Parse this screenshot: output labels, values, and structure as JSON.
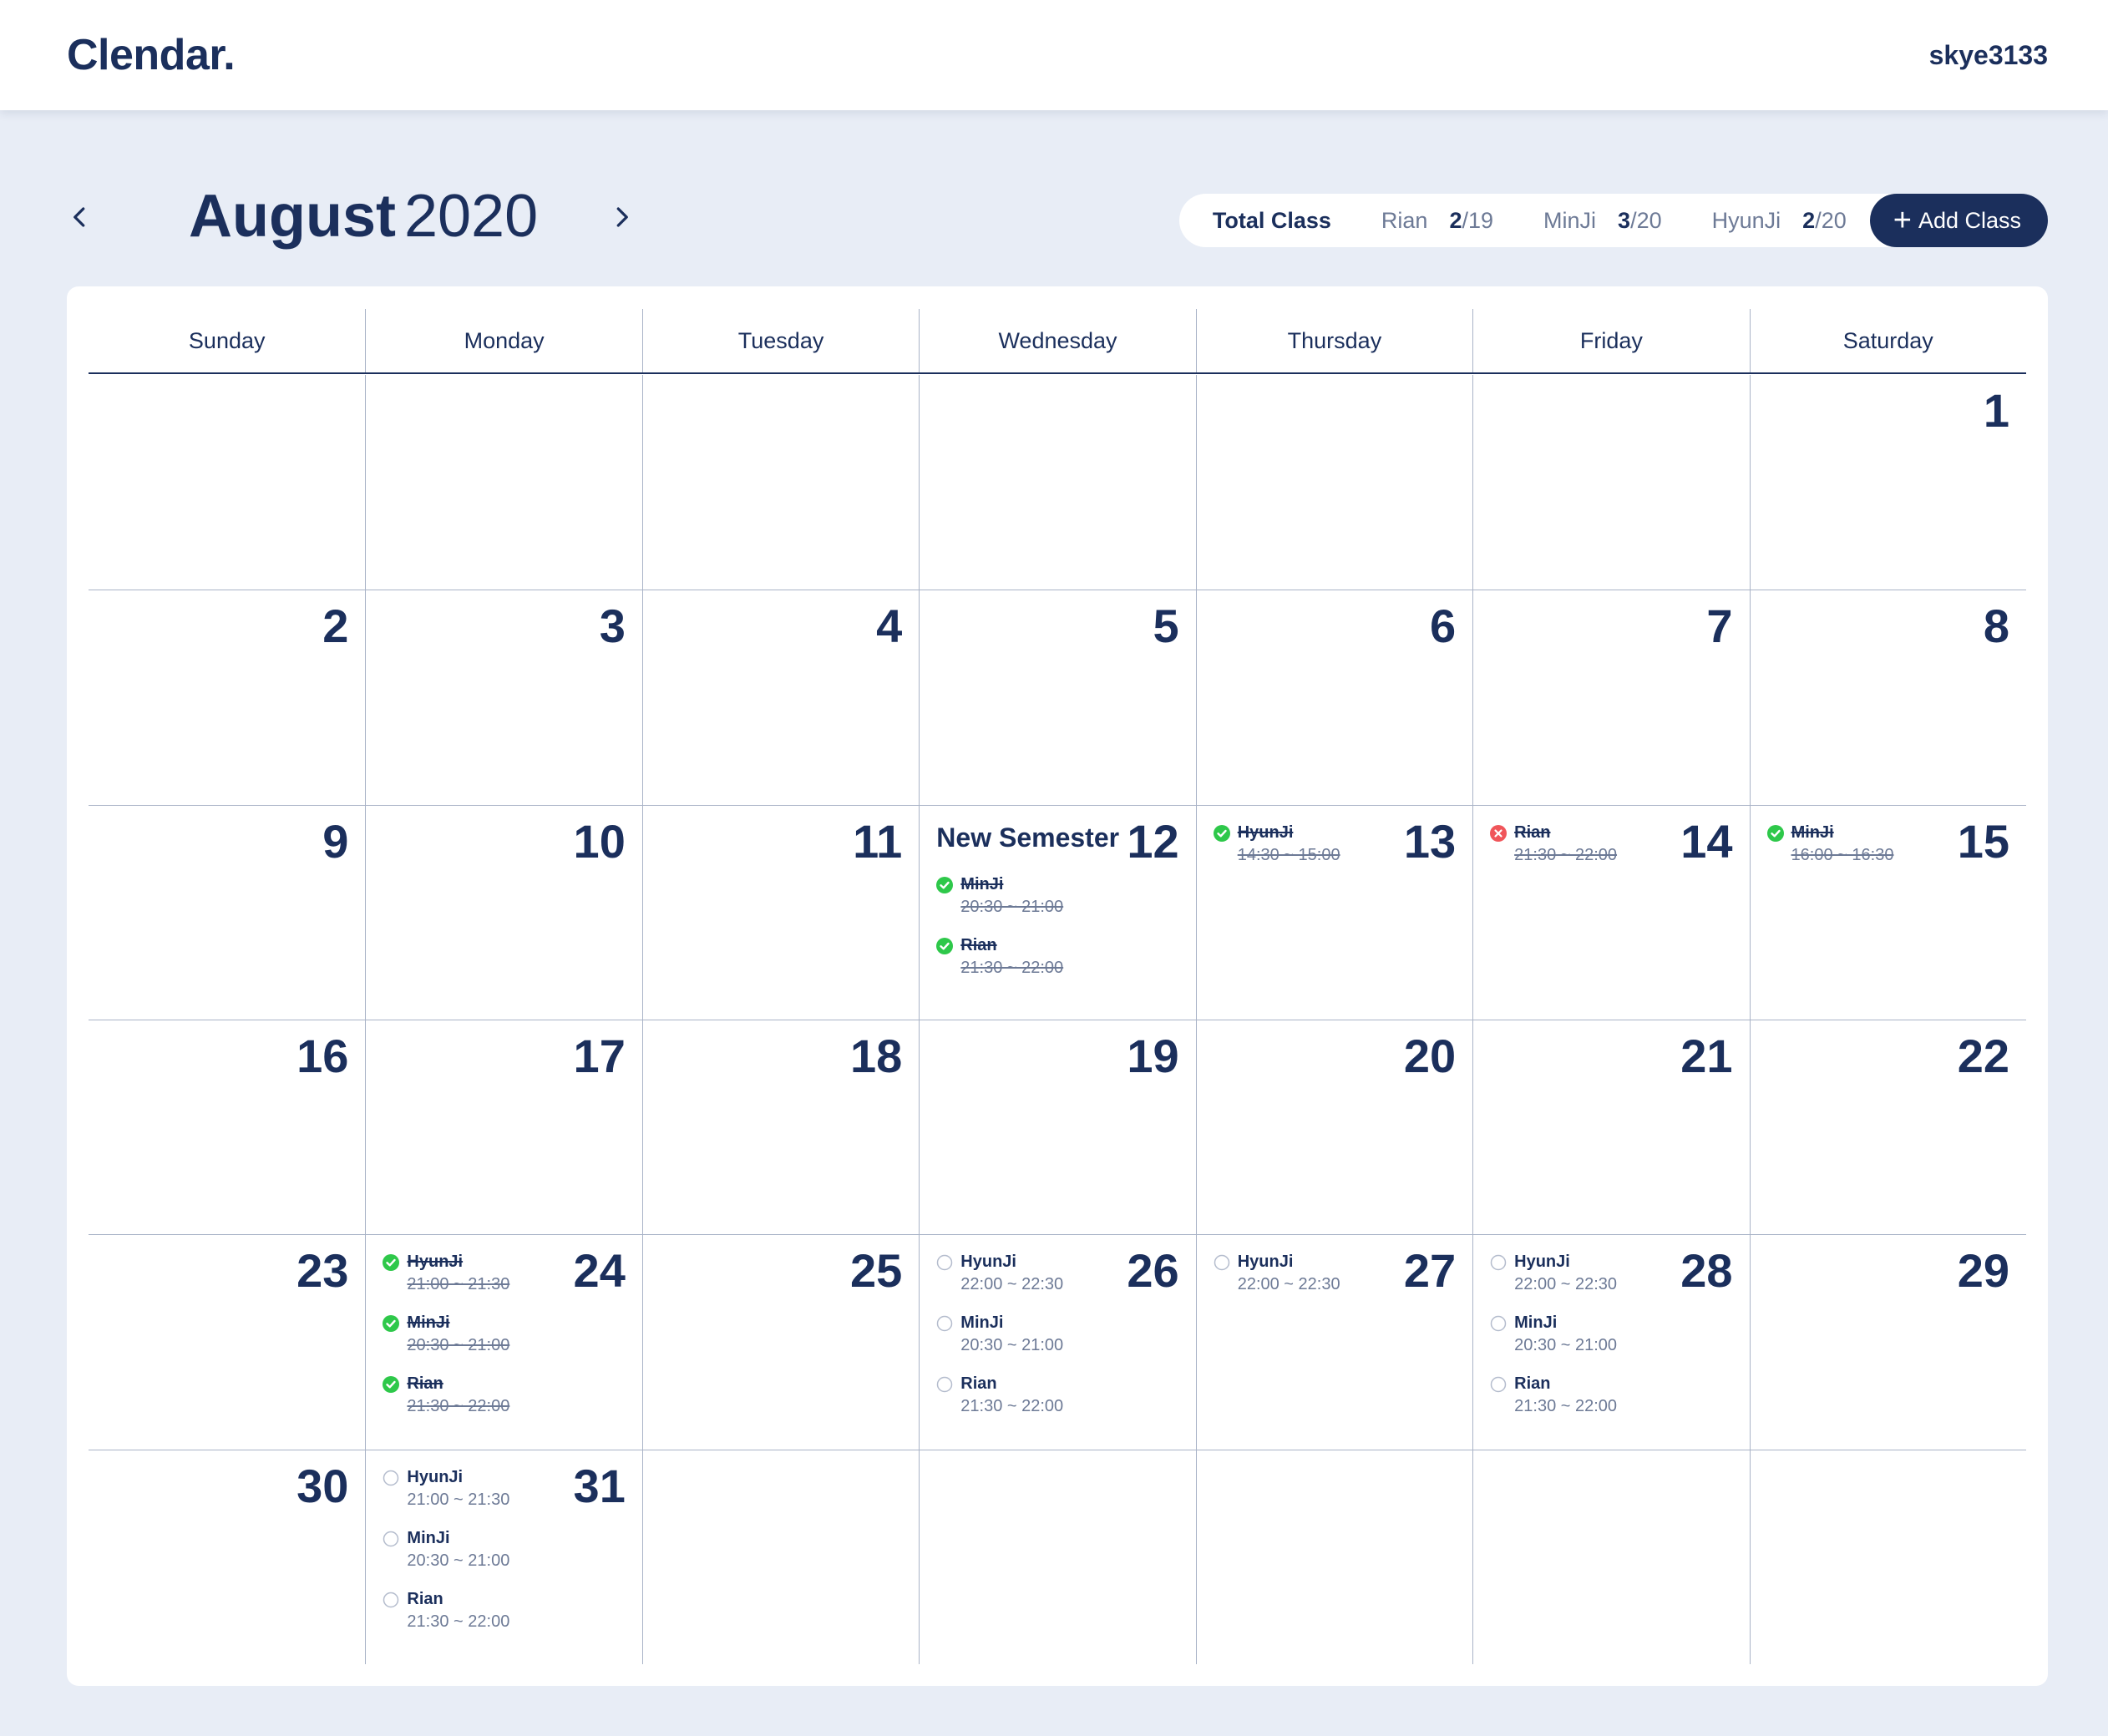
{
  "app": {
    "logo": "Clendar.",
    "username": "skye3133"
  },
  "nav": {
    "month": "August",
    "year": "2020"
  },
  "stats": {
    "total_label": "Total Class",
    "items": [
      {
        "name": "Rian",
        "done": "2",
        "total": "/19"
      },
      {
        "name": "MinJi",
        "done": "3",
        "total": "/20"
      },
      {
        "name": "HyunJi",
        "done": "2",
        "total": "/20"
      }
    ]
  },
  "add_button": {
    "label": "Add Class"
  },
  "colors": {
    "primary": "#1b2f5c",
    "background": "#e8edf6",
    "done": "#2ec84a",
    "cancelled": "#f0555a",
    "muted": "#6d7a96"
  },
  "weekdays": [
    "Sunday",
    "Monday",
    "Tuesday",
    "Wednesday",
    "Thursday",
    "Friday",
    "Saturday"
  ],
  "weeks": [
    [
      {
        "day": ""
      },
      {
        "day": ""
      },
      {
        "day": ""
      },
      {
        "day": ""
      },
      {
        "day": ""
      },
      {
        "day": ""
      },
      {
        "day": "1"
      }
    ],
    [
      {
        "day": "2"
      },
      {
        "day": "3"
      },
      {
        "day": "4"
      },
      {
        "day": "5"
      },
      {
        "day": "6"
      },
      {
        "day": "7"
      },
      {
        "day": "8"
      }
    ],
    [
      {
        "day": "9"
      },
      {
        "day": "10"
      },
      {
        "day": "11"
      },
      {
        "day": "12",
        "title": "New Semester",
        "classes": [
          {
            "name": "MinJi",
            "time": "20:30 ~ 21:00",
            "status": "done"
          },
          {
            "name": "Rian",
            "time": "21:30 ~ 22:00",
            "status": "done"
          }
        ]
      },
      {
        "day": "13",
        "classes": [
          {
            "name": "HyunJi",
            "time": "14:30 ~ 15:00",
            "status": "done"
          }
        ]
      },
      {
        "day": "14",
        "classes": [
          {
            "name": "Rian",
            "time": "21:30 ~ 22:00",
            "status": "cancelled"
          }
        ]
      },
      {
        "day": "15",
        "classes": [
          {
            "name": "MinJi",
            "time": "16:00 ~ 16:30",
            "status": "done"
          }
        ]
      }
    ],
    [
      {
        "day": "16"
      },
      {
        "day": "17"
      },
      {
        "day": "18"
      },
      {
        "day": "19"
      },
      {
        "day": "20"
      },
      {
        "day": "21"
      },
      {
        "day": "22"
      }
    ],
    [
      {
        "day": "23"
      },
      {
        "day": "24",
        "classes": [
          {
            "name": "HyunJi",
            "time": "21:00 ~ 21:30",
            "status": "done"
          },
          {
            "name": "MinJi",
            "time": "20:30 ~ 21:00",
            "status": "done"
          },
          {
            "name": "Rian",
            "time": "21:30 ~ 22:00",
            "status": "done"
          }
        ]
      },
      {
        "day": "25"
      },
      {
        "day": "26",
        "classes": [
          {
            "name": "HyunJi",
            "time": "22:00 ~ 22:30",
            "status": "pending"
          },
          {
            "name": "MinJi",
            "time": "20:30 ~ 21:00",
            "status": "pending"
          },
          {
            "name": "Rian",
            "time": "21:30 ~ 22:00",
            "status": "pending"
          }
        ]
      },
      {
        "day": "27",
        "classes": [
          {
            "name": "HyunJi",
            "time": "22:00 ~ 22:30",
            "status": "pending"
          }
        ]
      },
      {
        "day": "28",
        "classes": [
          {
            "name": "HyunJi",
            "time": "22:00 ~ 22:30",
            "status": "pending"
          },
          {
            "name": "MinJi",
            "time": "20:30 ~ 21:00",
            "status": "pending"
          },
          {
            "name": "Rian",
            "time": "21:30 ~ 22:00",
            "status": "pending"
          }
        ]
      },
      {
        "day": "29"
      }
    ],
    [
      {
        "day": "30"
      },
      {
        "day": "31",
        "classes": [
          {
            "name": "HyunJi",
            "time": "21:00 ~ 21:30",
            "status": "pending"
          },
          {
            "name": "MinJi",
            "time": "20:30 ~ 21:00",
            "status": "pending"
          },
          {
            "name": "Rian",
            "time": "21:30 ~ 22:00",
            "status": "pending"
          }
        ]
      },
      {
        "day": ""
      },
      {
        "day": ""
      },
      {
        "day": ""
      },
      {
        "day": ""
      },
      {
        "day": ""
      }
    ]
  ]
}
